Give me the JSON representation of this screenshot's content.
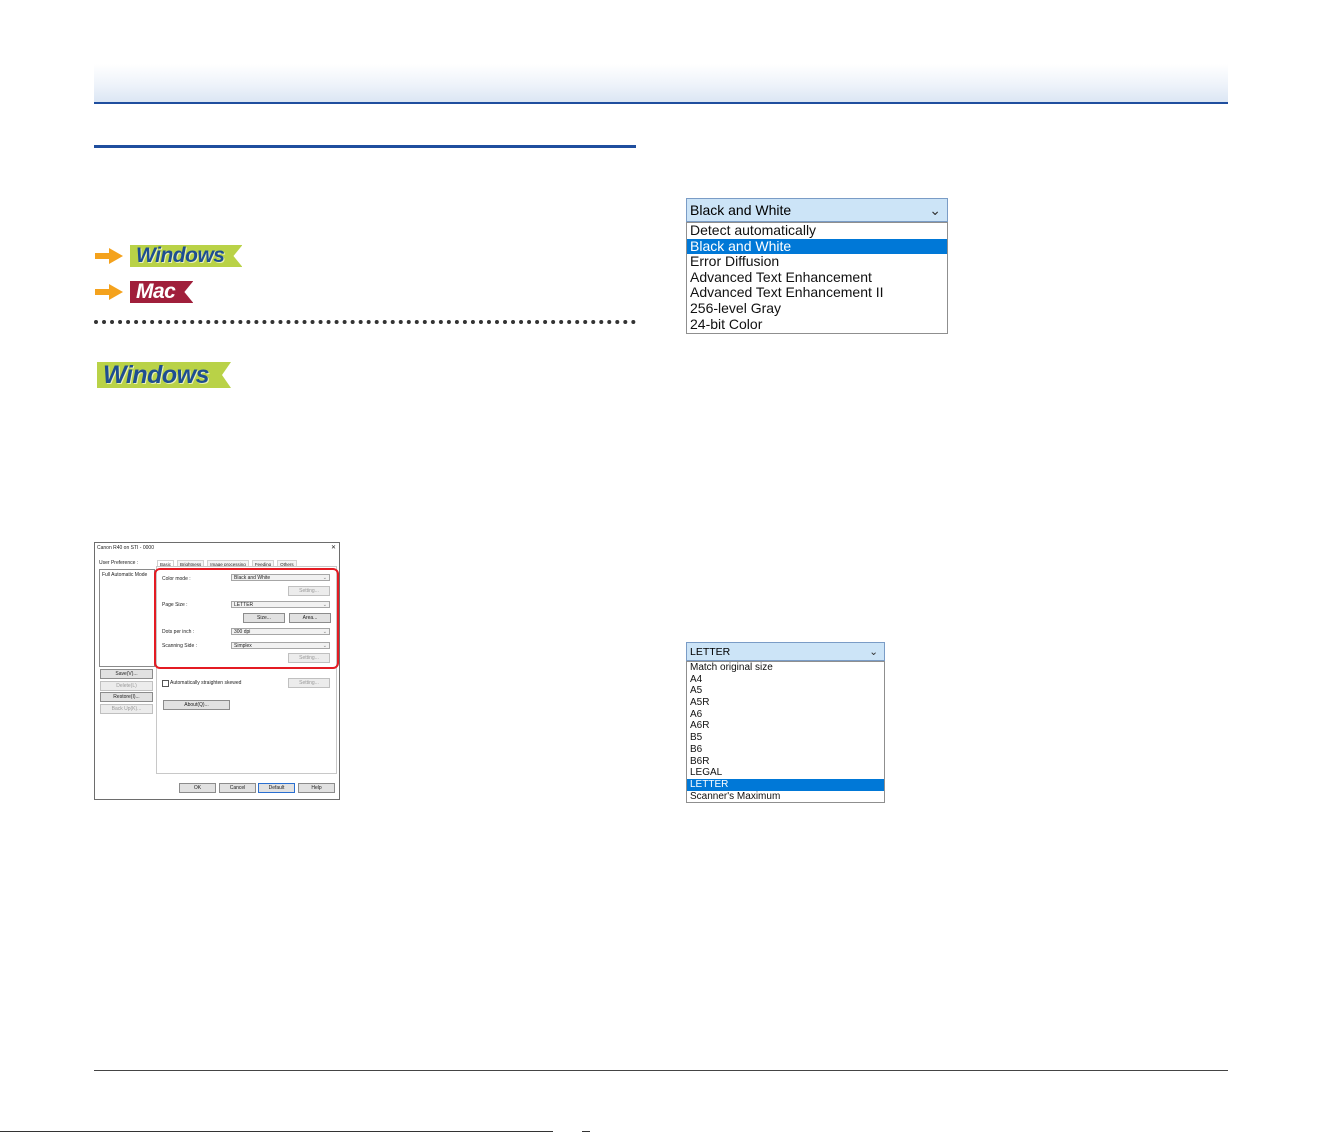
{
  "banners": {
    "windows": "Windows",
    "mac": "Mac"
  },
  "dialog": {
    "title": "Canon R40 on STI - 0000",
    "close_glyph": "✕",
    "user_preference_label": "User Preference :",
    "preference_items": [
      "Full Automatic Mode"
    ],
    "tabs": [
      "Basic",
      "Brightness",
      "Image processing",
      "Feeding",
      "Others"
    ],
    "color_mode_label": "Color mode :",
    "color_mode_value": "Black and White",
    "page_size_label": "Page Size :",
    "page_size_value": "LETTER",
    "dpi_label": "Dots per inch :",
    "dpi_value": "300 dpi",
    "scanning_side_label": "Scanning Side :",
    "scanning_side_value": "Simplex",
    "setting_label": "Setting...",
    "save_label": "Save(V)...",
    "delete_label": "Delete(L)",
    "restore_label": "Restore(I)...",
    "backup_label": "Back Up(K)...",
    "size_label": "Size...",
    "area_label": "Area...",
    "auto_straighten_label": "Automatically straighten skewed",
    "about_label": "About(Q)...",
    "ok_label": "OK",
    "cancel_label": "Cancel",
    "default_label": "Default",
    "help_label": "Help"
  },
  "color_mode_dropdown": {
    "selected": "Black and White",
    "options": [
      "Detect automatically",
      "Black and White",
      "Error Diffusion",
      "Advanced Text Enhancement",
      "Advanced Text Enhancement II",
      "256-level Gray",
      "24-bit Color"
    ],
    "highlighted_index": 1
  },
  "page_size_dropdown": {
    "selected": "LETTER",
    "options": [
      "Match original size",
      "A4",
      "A5",
      "A5R",
      "A6",
      "A6R",
      "B5",
      "B6",
      "B6R",
      "LEGAL",
      "LETTER",
      "Scanner's Maximum"
    ],
    "highlighted_index": 10
  },
  "icons": {
    "arrow": "orange-right-arrow-icon",
    "chevron": "chevron-down-icon",
    "close": "close-icon"
  },
  "colors": {
    "accent_blue": "#1f4e9e",
    "windows_green": "#b9d247",
    "mac_red": "#a01f3b",
    "highlight": "#0078d7",
    "dialog_highlight_box": "#e41b23"
  }
}
